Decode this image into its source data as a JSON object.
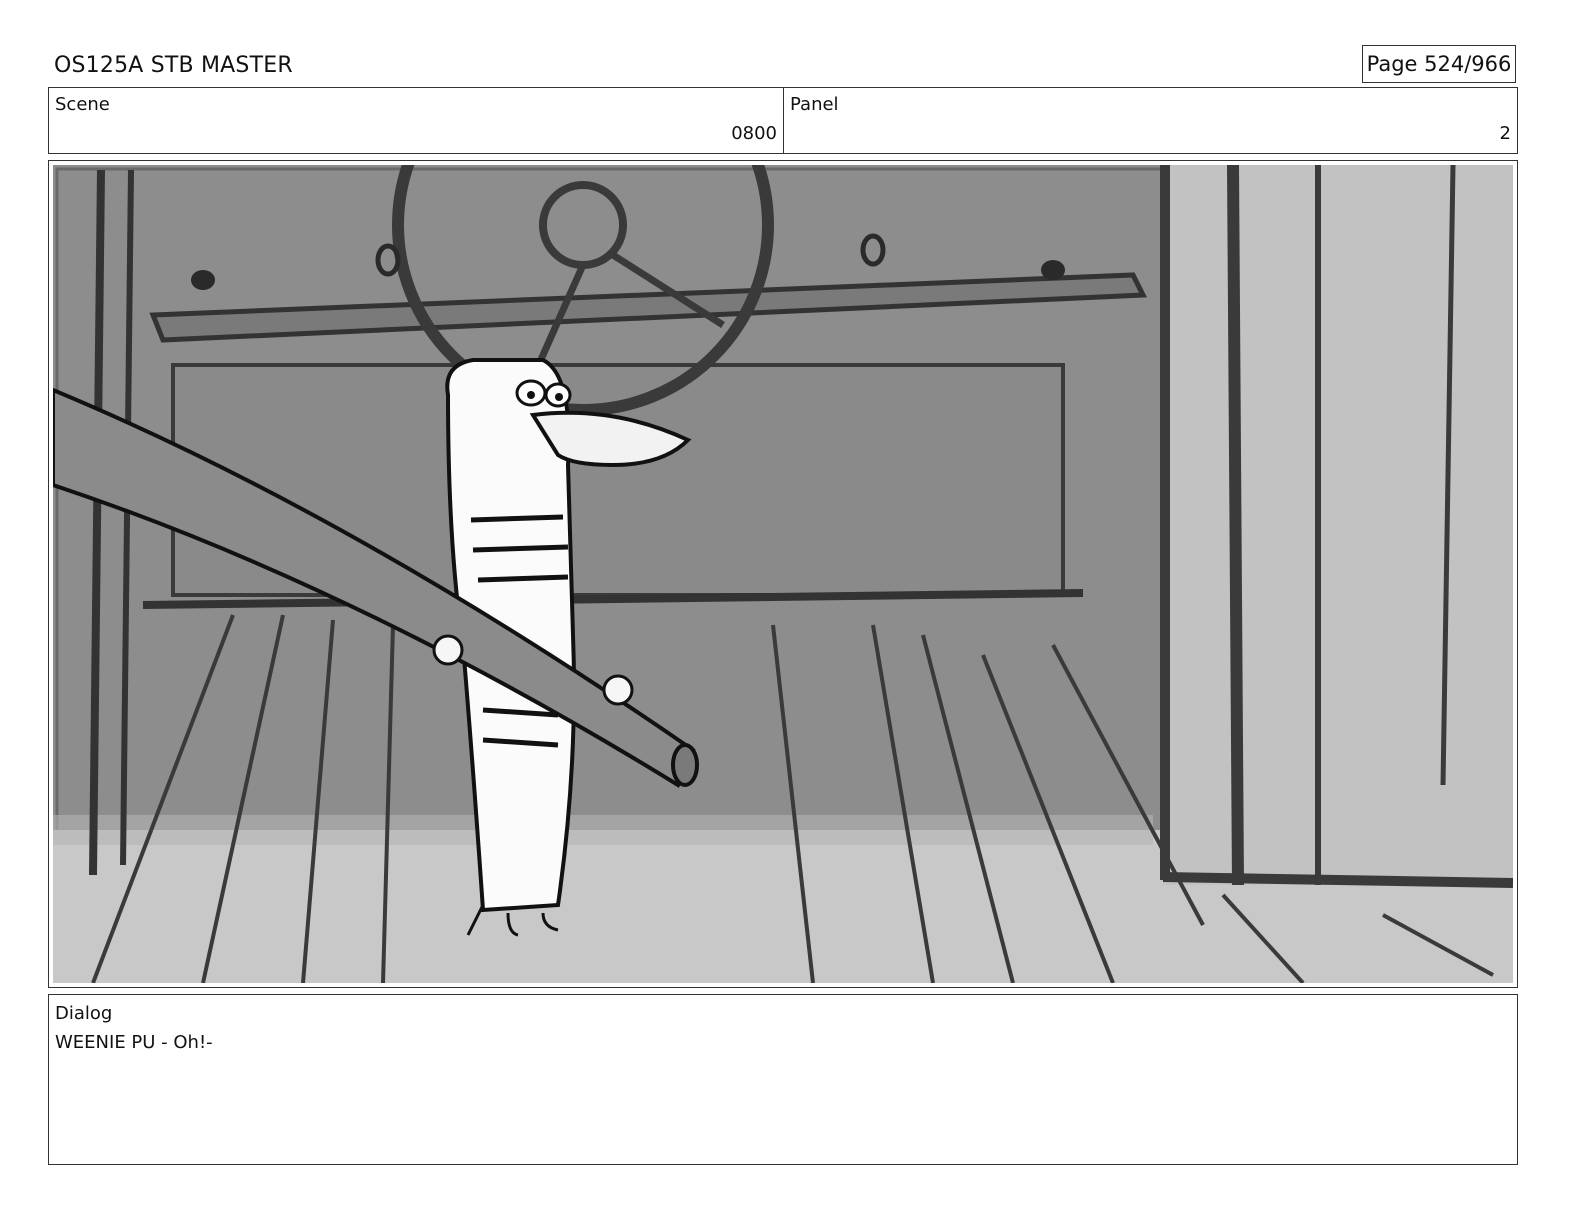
{
  "header": {
    "title": "OS125A STB MASTER",
    "page": "Page 524/966"
  },
  "scene": {
    "label": "Scene",
    "value": "0800"
  },
  "panel": {
    "label": "Panel",
    "value": "2"
  },
  "frame": {
    "description_icon": "storyboard-sketch-image"
  },
  "dialog": {
    "label": "Dialog",
    "text": "WEENIE PU - Oh!-"
  }
}
